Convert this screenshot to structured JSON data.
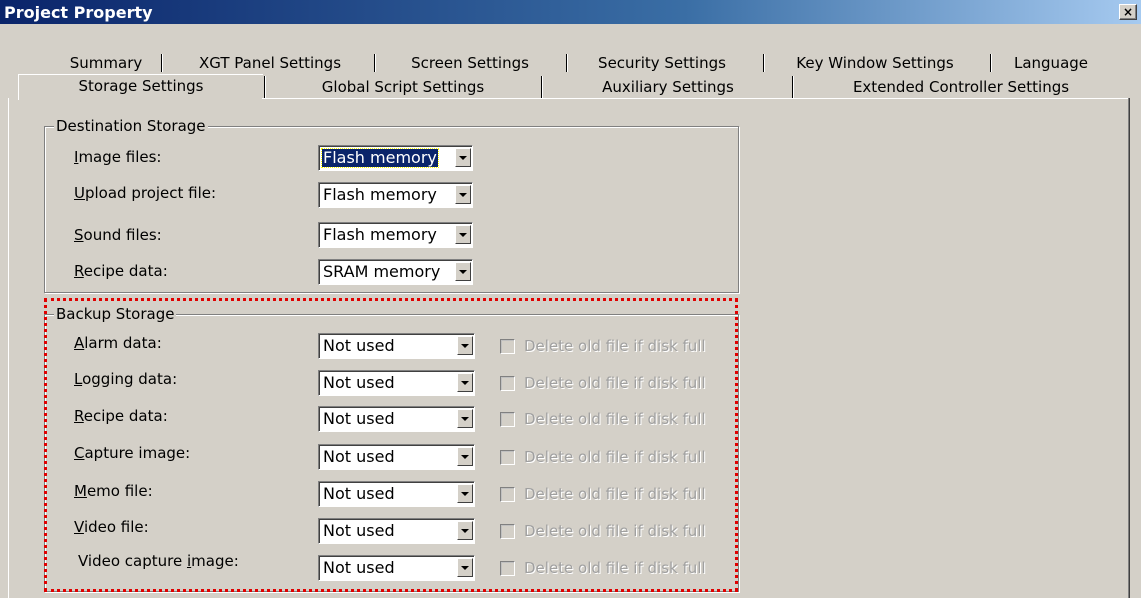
{
  "window": {
    "title": "Project Property",
    "close_label": "×"
  },
  "tabs_row1": [
    "Summary",
    "XGT Panel Settings",
    "Screen Settings",
    "Security Settings",
    "Key Window Settings",
    "Language"
  ],
  "tabs_row2": [
    "Storage Settings",
    "Global Script Settings",
    "Auxiliary Settings",
    "Extended Controller Settings"
  ],
  "active_tab": "Storage Settings",
  "destination": {
    "legend": "Destination Storage",
    "rows": [
      {
        "key": "I",
        "rest": "mage files:",
        "value": "Flash memory"
      },
      {
        "key": "U",
        "rest": "pload project file:",
        "value": "Flash memory"
      },
      {
        "key": "S",
        "rest": "ound files:",
        "value": "Flash memory"
      },
      {
        "key": "R",
        "rest": "ecipe data:",
        "value": "SRAM memory"
      }
    ]
  },
  "backup": {
    "legend": "Backup Storage",
    "checkbox_label": "Delete old file if disk full",
    "rows": [
      {
        "pre": "",
        "key": "A",
        "rest": "larm data:",
        "value": "Not used"
      },
      {
        "pre": "",
        "key": "L",
        "rest": "ogging data:",
        "value": "Not used"
      },
      {
        "pre": "",
        "key": "R",
        "rest": "ecipe data:",
        "value": "Not used"
      },
      {
        "pre": "",
        "key": "C",
        "rest": "apture image:",
        "value": "Not used"
      },
      {
        "pre": "",
        "key": "M",
        "rest": "emo file:",
        "value": "Not used"
      },
      {
        "pre": "",
        "key": "V",
        "rest": "ideo file:",
        "value": "Not used"
      },
      {
        "pre": "Video capture ",
        "key": "i",
        "rest": "mage:",
        "value": "Not used"
      }
    ]
  }
}
